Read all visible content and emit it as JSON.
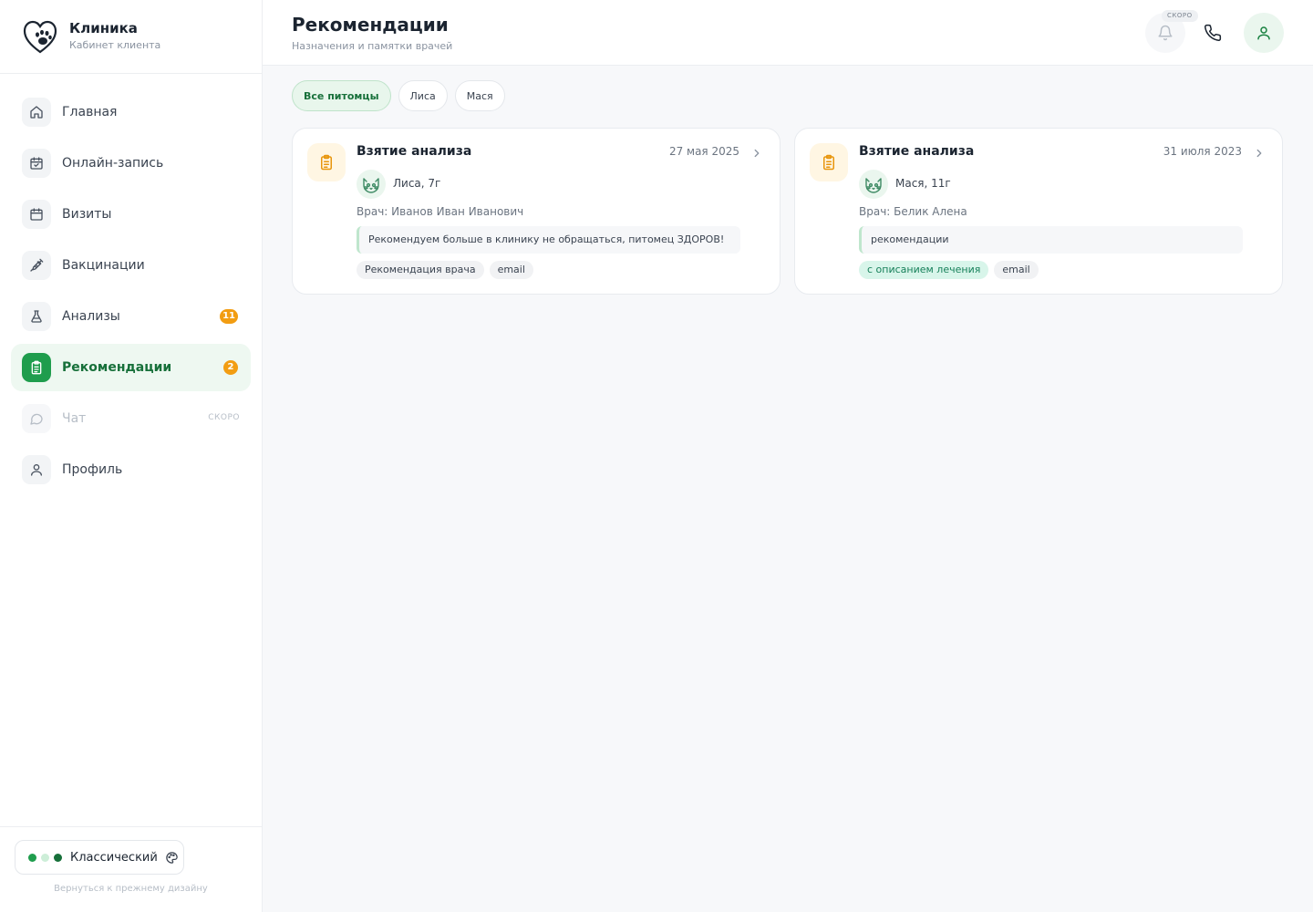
{
  "brand": {
    "title": "Клиника",
    "subtitle": "Кабинет клиента"
  },
  "sidebar": {
    "items": [
      {
        "label": "Главная",
        "icon": "home-icon"
      },
      {
        "label": "Онлайн-запись",
        "icon": "calendar-check-icon"
      },
      {
        "label": "Визиты",
        "icon": "calendar-icon"
      },
      {
        "label": "Вакцинации",
        "icon": "syringe-icon"
      },
      {
        "label": "Анализы",
        "icon": "flask-icon",
        "badge": "11"
      },
      {
        "label": "Рекомендации",
        "icon": "clipboard-icon",
        "badge": "2",
        "active": true
      },
      {
        "label": "Чат",
        "icon": "chat-icon",
        "soon": "СКОРО",
        "disabled": true
      },
      {
        "label": "Профиль",
        "icon": "user-icon"
      }
    ]
  },
  "theme": {
    "label": "Классический",
    "dots": [
      "#1f9d4d",
      "#cdeed8",
      "#17703a"
    ]
  },
  "back_link": "Вернуться к прежнему дизайну",
  "header": {
    "title": "Рекомендации",
    "subtitle": "Назначения и памятки врачей",
    "soon_tag": "СКОРО"
  },
  "filters": [
    "Все питомцы",
    "Лиса",
    "Мася"
  ],
  "cards": [
    {
      "title": "Взятие анализа",
      "date": "27 мая 2025",
      "pet": "Лиса, 7г",
      "doctor": "Врач: Иванов Иван Иванович",
      "note": "Рекомендуем больше в клинику не обращаться, питомец ЗДОРОВ!",
      "tags": [
        "Рекомендация врача",
        "email"
      ]
    },
    {
      "title": "Взятие анализа",
      "date": "31 июля 2023",
      "pet": "Мася, 11г",
      "doctor": "Врач: Белик Алена",
      "note": "рекомендации",
      "tags": [
        "с описанием лечения",
        "email"
      ]
    }
  ],
  "colors": {
    "accent": "#1f9d4d",
    "badge": "#f29d12",
    "card_icon": "#e8950c"
  }
}
